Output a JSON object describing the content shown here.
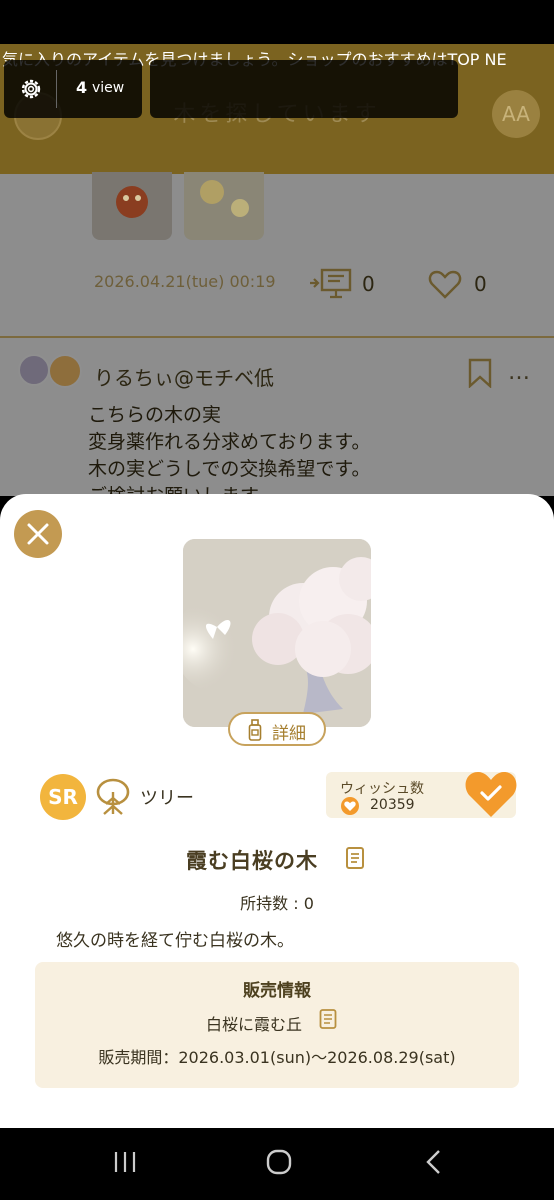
{
  "header": {
    "marquee_text": "気に入りのアイテムを見つけましょう。ショップのおすすめはTOP NE",
    "title": "木を探しています",
    "font_size_button": "AA"
  },
  "view_overlay": {
    "count": "4",
    "label": "view",
    "icon": "gear-icon"
  },
  "feed": {
    "previous_post": {
      "date": "2026.04.21(tue) 00:19",
      "present_count": "0",
      "like_count": "0"
    },
    "post": {
      "username": "りるちぃ@モチベ低",
      "more": "…",
      "body_lines": [
        "こちらの木の実",
        "変身薬作れる分求めております。",
        "木の実どうしでの交換希望です。",
        "ご検討お願いします。"
      ]
    }
  },
  "item_sheet": {
    "detail_button": "詳細",
    "rarity": "SR",
    "category": "ツリー",
    "wish_label": "ウィッシュ数",
    "wish_count": "20359",
    "item_name": "霞む白桜の木",
    "owned": "所持数 : 0",
    "description": "悠久の時を経て佇む白桜の木。",
    "sale": {
      "title": "販売情報",
      "place": "白桜に霞む丘",
      "period": "販売期間：2026.03.01(sun)〜2026.08.29(sat)"
    }
  },
  "colors": {
    "accent_gold": "#c39a52",
    "wish_orange": "#f39a2c",
    "rarity_yellow": "#f2b53d",
    "sale_bg": "#f8f0e0"
  }
}
